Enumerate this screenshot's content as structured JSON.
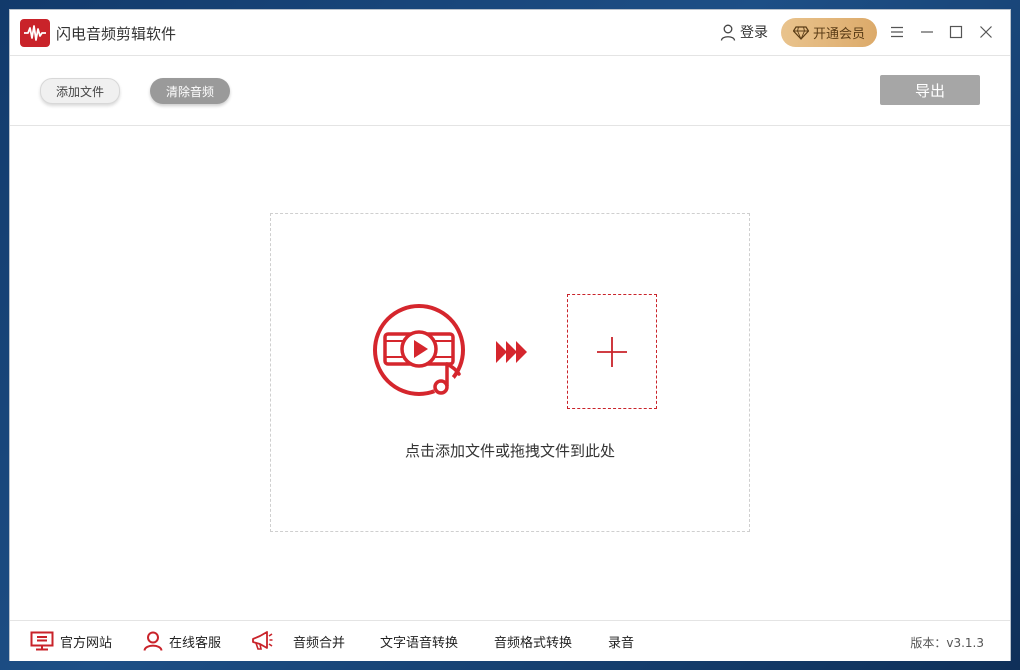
{
  "app": {
    "title": "闪电音频剪辑软件",
    "login_label": "登录",
    "vip_label": "开通会员"
  },
  "toolbar": {
    "add_file_label": "添加文件",
    "clear_audio_label": "清除音频",
    "export_label": "导出"
  },
  "dropzone": {
    "hint": "点击添加文件或拖拽文件到此处"
  },
  "footer": {
    "items": [
      {
        "label": "官方网站",
        "icon": "monitor-icon"
      },
      {
        "label": "在线客服",
        "icon": "person-icon"
      },
      {
        "label": "音频合并",
        "icon": "megaphone-icon"
      },
      {
        "label": "文字语音转换"
      },
      {
        "label": "音频格式转换"
      },
      {
        "label": "录音"
      }
    ],
    "version": "版本：v3.1.3"
  },
  "colors": {
    "brand_red": "#c9232a",
    "vip_gold": "#e1b47a",
    "export_gray": "#a6a6a6"
  }
}
